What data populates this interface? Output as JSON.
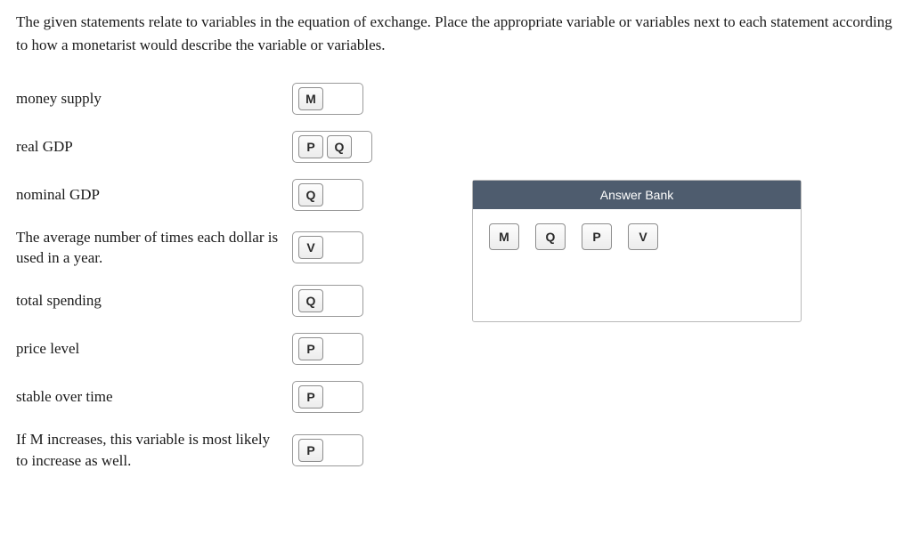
{
  "instructions": "The given statements relate to variables in the equation of exchange. Place the appropriate variable or variables next to each statement according to how a monetarist would describe the variable or variables.",
  "rows": [
    {
      "label": "money supply",
      "tiles": [
        "M"
      ]
    },
    {
      "label": "real GDP",
      "tiles": [
        "P",
        "Q"
      ]
    },
    {
      "label": "nominal GDP",
      "tiles": [
        "Q"
      ]
    },
    {
      "label": "The average number of times each dollar is used in a year.",
      "tiles": [
        "V"
      ]
    },
    {
      "label": "total spending",
      "tiles": [
        "Q"
      ]
    },
    {
      "label": "price level",
      "tiles": [
        "P"
      ]
    },
    {
      "label": "stable over time",
      "tiles": [
        "P"
      ]
    },
    {
      "label": "If M increases, this variable is most likely to increase as well.",
      "tiles": [
        "P"
      ]
    }
  ],
  "answer_bank": {
    "title": "Answer Bank",
    "tiles": [
      "M",
      "Q",
      "P",
      "V"
    ]
  }
}
